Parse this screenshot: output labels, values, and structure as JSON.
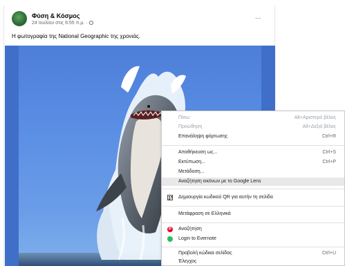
{
  "post": {
    "page_name": "Φύση & Κόσμος",
    "date": "24 Ιουλίου στις 6:55 π.μ. ·",
    "more_label": "...",
    "caption": "Η φωτογραφία της National Geographic της χρονιάς."
  },
  "context_menu": {
    "items": [
      {
        "label": "Πίσω",
        "shortcut": "Alt+Αριστερό βέλος"
      },
      {
        "label": "Προώθηση",
        "shortcut": "Alt+Δεξιό βέλος"
      },
      {
        "label": "Επανάληψη φόρτωσης",
        "shortcut": "Ctrl+R"
      },
      {
        "label": "Αποθήκευση ως...",
        "shortcut": "Ctrl+S"
      },
      {
        "label": "Εκτύπωση...",
        "shortcut": "Ctrl+P"
      },
      {
        "label": "Μετάδοση..."
      },
      {
        "label": "Αναζήτηση εικόνων με το Google Lens"
      },
      {
        "label": "Δημιουργία κωδικού QR για αυτήν τη σελίδα"
      },
      {
        "label": "Μετάφραση σε Ελληνικά"
      },
      {
        "label": "Αναζήτηση"
      },
      {
        "label": "Login to Evernote"
      },
      {
        "label": "Προβολή κώδικα σελίδας",
        "shortcut": "Ctrl+U"
      },
      {
        "label": "Έλεγχος"
      }
    ]
  },
  "icons": {
    "qr": "qr-code-icon",
    "pinterest": "pinterest-icon",
    "evernote": "evernote-icon"
  },
  "colors": {
    "highlight": "#e8e8e9",
    "disabled_text": "#9aa0a6",
    "pinterest": "#e60023",
    "evernote": "#2dbe60"
  }
}
